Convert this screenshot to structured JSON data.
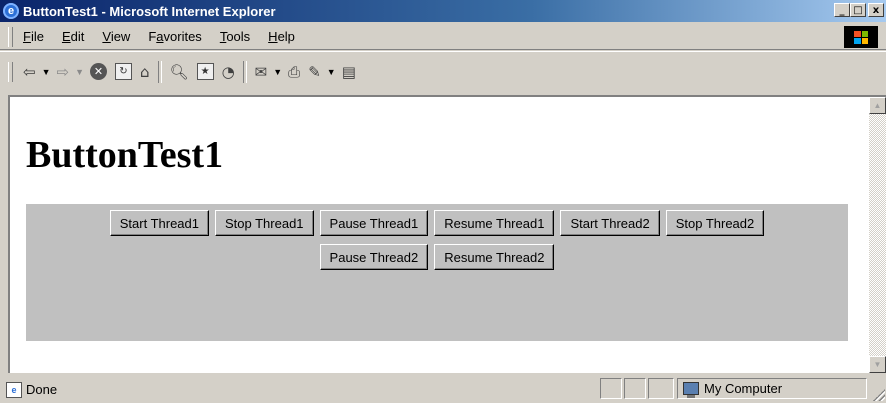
{
  "window": {
    "title": "ButtonTest1 - Microsoft Internet Explorer",
    "controls": [
      "_",
      "□",
      "x"
    ]
  },
  "menu": [
    {
      "label_pre": "",
      "label_key": "F",
      "label_post": "ile"
    },
    {
      "label_pre": "",
      "label_key": "E",
      "label_post": "dit"
    },
    {
      "label_pre": "",
      "label_key": "V",
      "label_post": "iew"
    },
    {
      "label_pre": "F",
      "label_key": "a",
      "label_post": "vorites"
    },
    {
      "label_pre": "",
      "label_key": "T",
      "label_post": "ools"
    },
    {
      "label_pre": "",
      "label_key": "H",
      "label_post": "elp"
    }
  ],
  "toolbar_icons": [
    "back-icon",
    "forward-icon",
    "stop-icon",
    "refresh-icon",
    "home-icon",
    "search-icon",
    "favorites-icon",
    "history-icon",
    "mail-icon",
    "print-icon",
    "edit-icon",
    "discuss-icon"
  ],
  "page": {
    "heading": "ButtonTest1",
    "applet_background": "#c0c0c0",
    "buttons_row1": [
      "Start Thread1",
      "Stop Thread1",
      "Pause Thread1",
      "Resume Thread1",
      "Start Thread2",
      "Stop Thread2"
    ],
    "buttons_row2": [
      "Pause Thread2",
      "Resume Thread2"
    ]
  },
  "status": {
    "text": "Done",
    "zone": "My Computer"
  }
}
